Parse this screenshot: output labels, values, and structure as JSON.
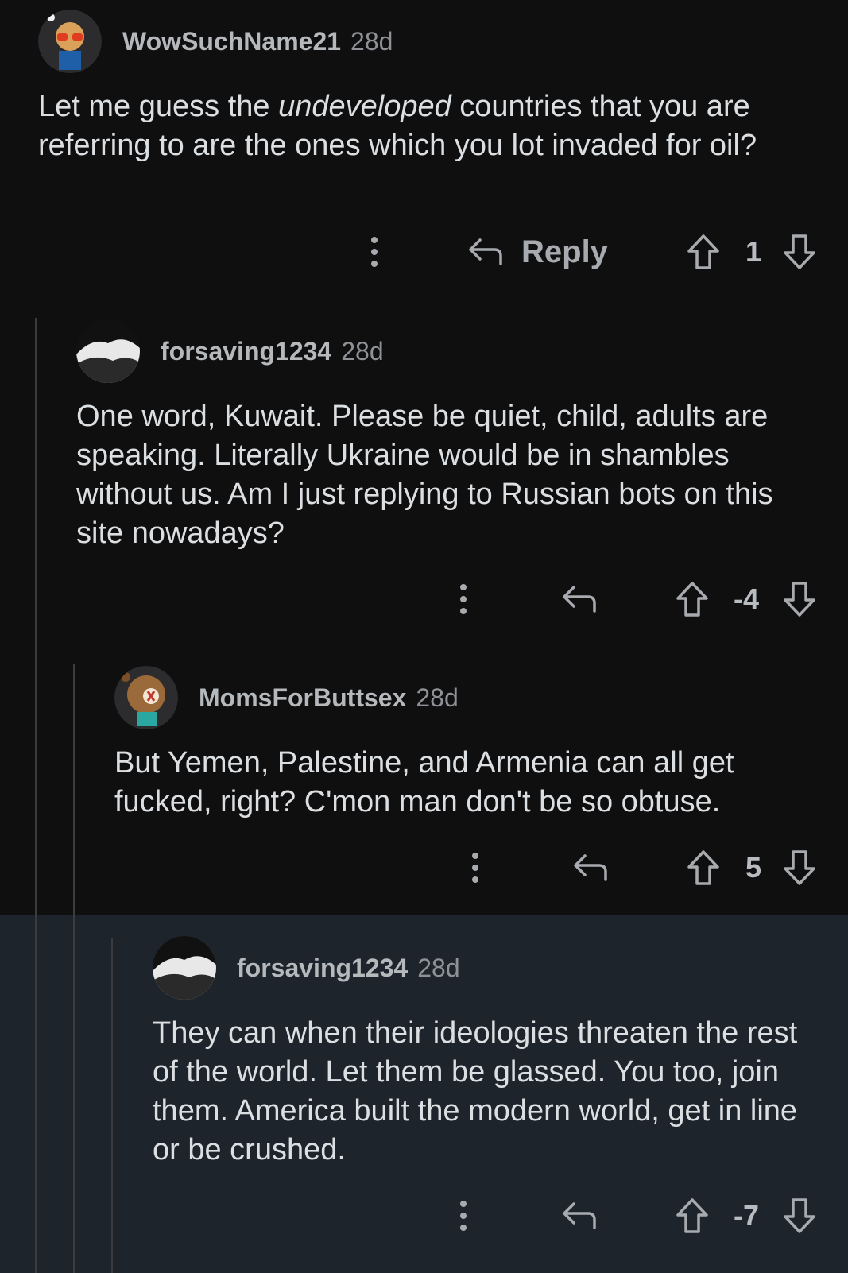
{
  "comments": [
    {
      "username": "WowSuchName21",
      "age": "28d",
      "body_before": "Let me guess the ",
      "body_em": "undeveloped",
      "body_after": " countries that you are referring to are the ones which you lot invaded for oil?",
      "reply_label": "Reply",
      "score": "1"
    },
    {
      "username": "forsaving1234",
      "age": "28d",
      "body": "One word, Kuwait. Please be quiet, child, adults are speaking. Literally Ukraine would be in shambles without us. Am I just replying to Russian bots on this site nowadays?",
      "score": "-4"
    },
    {
      "username": "MomsForButtsex",
      "age": "28d",
      "body": "But Yemen, Palestine, and Armenia can all get fucked, right? C'mon man don't be so obtuse.",
      "score": "5"
    },
    {
      "username": "forsaving1234",
      "age": "28d",
      "body": "They can when their ideologies threaten the rest of the world. Let them be glassed. You too, join them. America built the modern world, get in line or be crushed.",
      "score": "-7"
    }
  ],
  "colors": {
    "background": "#0f0f10",
    "highlight": "#1e242c",
    "thread_line": "#3a3c3f"
  },
  "icons": [
    "more-vertical-icon",
    "reply-arrow-icon",
    "upvote-arrow-icon",
    "downvote-arrow-icon"
  ]
}
